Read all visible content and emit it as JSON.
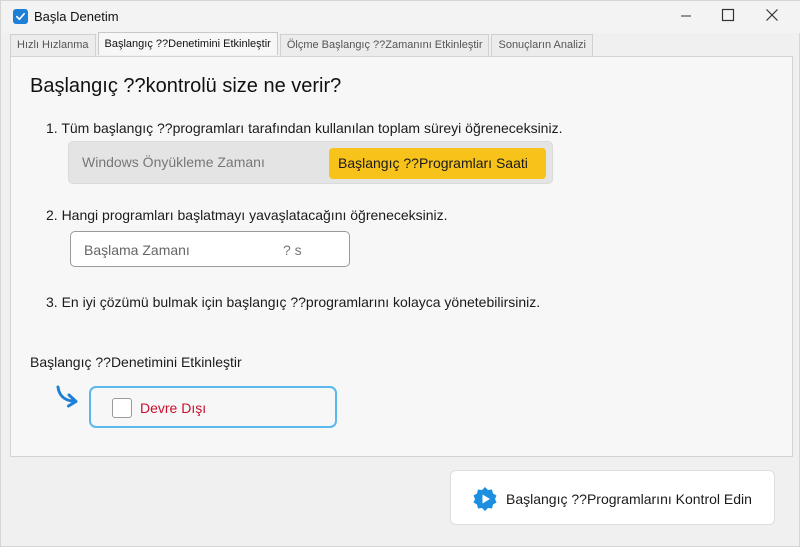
{
  "window": {
    "title": "Başla Denetim",
    "controls": [
      "minimize",
      "maximize",
      "close"
    ]
  },
  "tabs": [
    {
      "label": "Hızlı Hızlanma",
      "active": false
    },
    {
      "label": "Başlangıç ??Denetimini Etkinleştir",
      "active": true
    },
    {
      "label": "Ölçme Başlangıç ??Zamanını Etkinleştir",
      "active": false
    },
    {
      "label": "Sonuçların Analizi",
      "active": false
    }
  ],
  "main": {
    "heading": "Başlangıç ??kontrolü size ne verir?",
    "step1": "1. Tüm başlangıç ??programları tarafından kullanılan toplam süreyi öğreneceksiniz.",
    "segment": {
      "left_label": "Windows Önyükleme Zamanı",
      "right_label": "Başlangıç ??Programları Saati",
      "selected": "right"
    },
    "step2": "2. Hangi programları başlatmayı yavaşlatacağını öğreneceksiniz.",
    "startup_field": {
      "label": "Başlama Zamanı",
      "value": "? s"
    },
    "step3": "3. En iyi çözümü bulmak için başlangıç ??programlarını kolayca yönetebilirsiniz.",
    "toggle_title": "Başlangıç ??Denetimini Etkinleştir",
    "toggle": {
      "label": "Devre Dışı",
      "checked": false
    }
  },
  "footer": {
    "check_button_label": "Başlangıç ??Programlarını Kontrol Edin"
  },
  "colors": {
    "accent_yellow": "#f7c31a",
    "toggle_border": "#5bb8ec",
    "disabled_red": "#c8102e",
    "app_icon_blue": "#1d7fd6"
  },
  "icons": {
    "app": "checkmark-icon",
    "arrow": "curved-arrow-icon",
    "button": "play-gear-icon"
  }
}
